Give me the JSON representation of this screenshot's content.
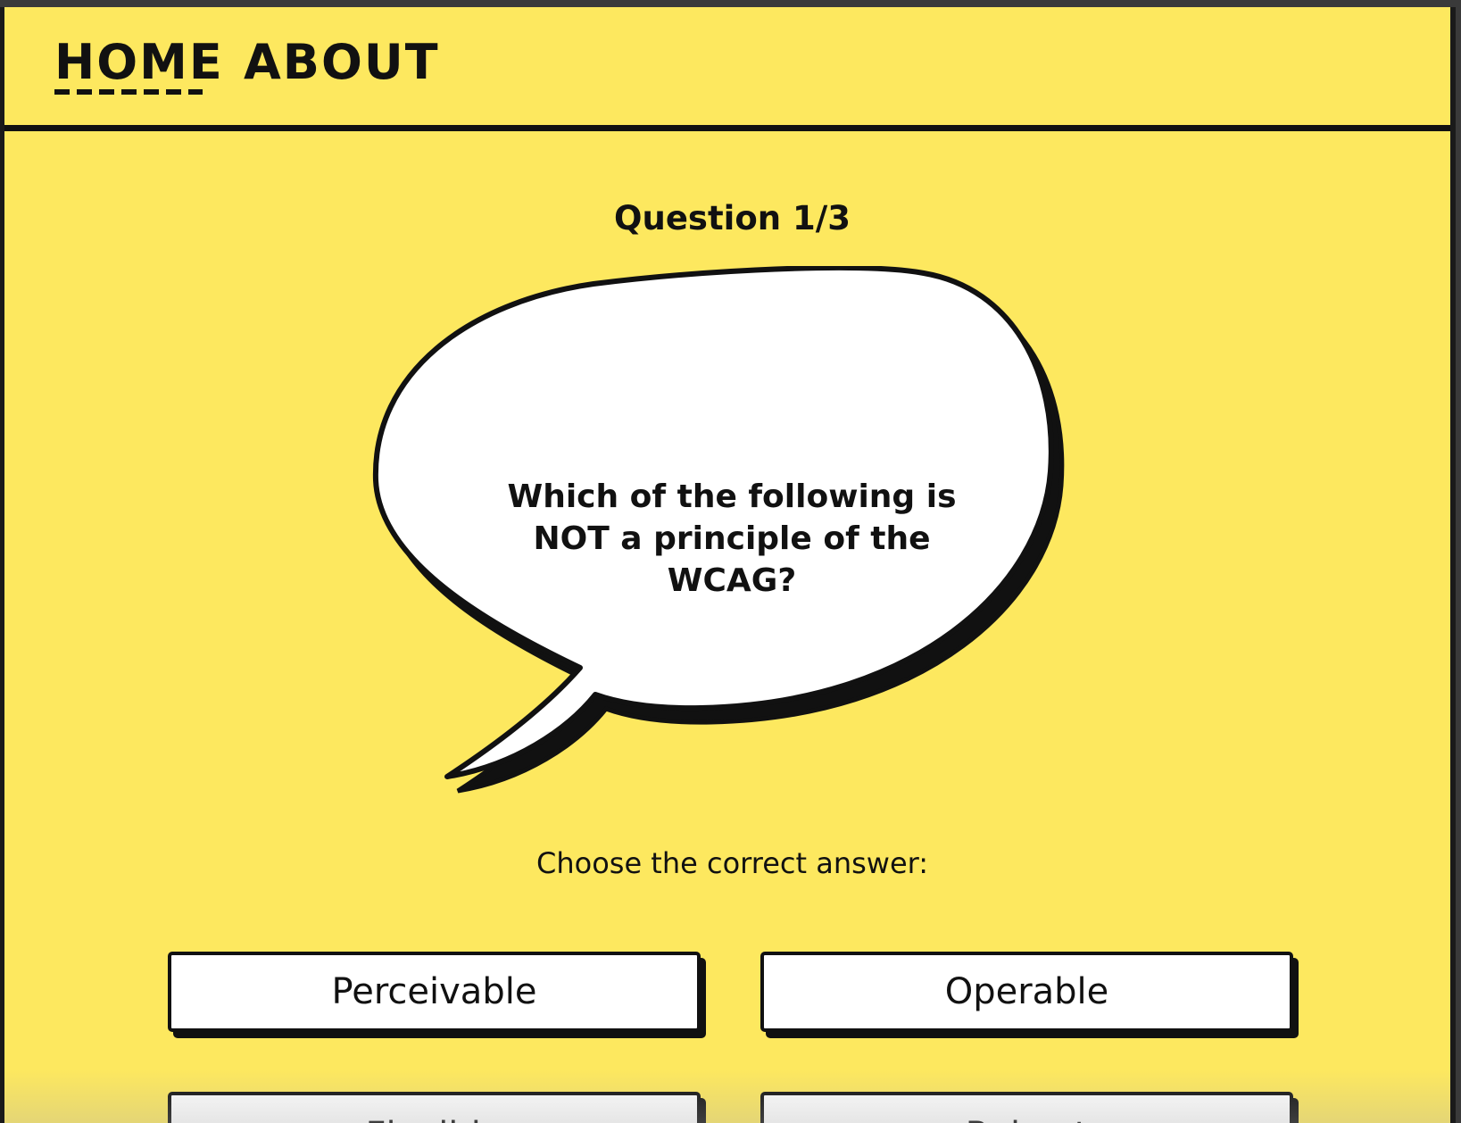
{
  "nav": {
    "home_label": "HOME",
    "about_label": "ABOUT",
    "active": "HOME"
  },
  "quiz": {
    "counter": "Question 1/3",
    "question": "Which of the following is NOT a principle of the WCAG?",
    "instruction": "Choose the correct answer:",
    "answers": [
      {
        "label": "Perceivable"
      },
      {
        "label": "Operable"
      },
      {
        "label": "Flexible"
      },
      {
        "label": "Robust"
      }
    ]
  },
  "colors": {
    "background": "#fde85f",
    "ink": "#111111",
    "button": "#ffffff"
  }
}
